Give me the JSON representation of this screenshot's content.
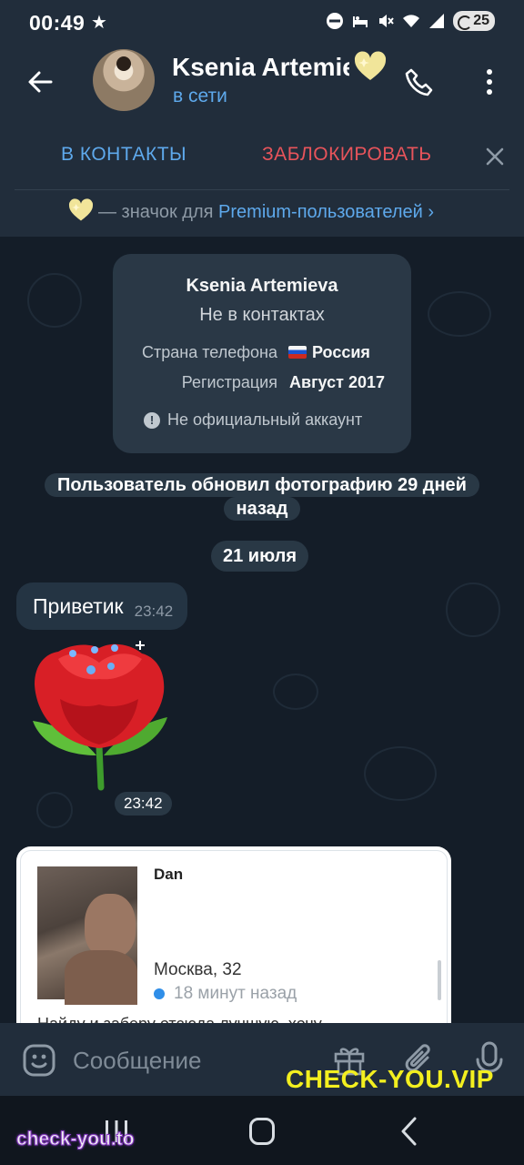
{
  "status_bar": {
    "time": "00:49",
    "star": "★",
    "battery": "25",
    "icons": [
      "star-icon",
      "dnd-icon",
      "bed-icon",
      "mute-icon",
      "wifi-icon",
      "signal-icon",
      "battery-icon"
    ]
  },
  "header": {
    "contact_name": "Ksenia Artemieva",
    "status": "в сети",
    "icons": [
      "back-arrow-icon",
      "premium-heart-icon",
      "phone-icon",
      "more-vert-icon"
    ]
  },
  "action_bar": {
    "add_contact": "В КОНТАКТЫ",
    "block": "ЗАБЛОКИРОВАТЬ"
  },
  "premium_notice": {
    "prefix": "— значок для ",
    "link": "Premium-пользователей",
    "chevron": "›"
  },
  "info_card": {
    "name": "Ksenia Artemieva",
    "subtitle": "Не в контактах",
    "phone_country_label": "Страна телефона",
    "phone_country_value": "Россия",
    "registration_label": "Регистрация",
    "registration_value": "Август 2017",
    "warning": "Не официальный аккаунт"
  },
  "service_message": "Пользователь обновил фотографию 29 дней назад",
  "date_chip": "21 июля",
  "messages": [
    {
      "type": "text",
      "text": "Приветик",
      "time": "23:42"
    },
    {
      "type": "sticker",
      "sticker": "red-rose",
      "time": "23:42"
    }
  ],
  "profile_card": {
    "name": "Dan",
    "city_age": "Москва, 32",
    "online": "18 минут назад",
    "description": "Найду и заберу отсюда лучшую, хочу"
  },
  "input_bar": {
    "placeholder": "Сообщение",
    "icons": [
      "emoji-icon",
      "gift-icon",
      "attach-icon",
      "mic-icon"
    ]
  },
  "watermarks": {
    "big": "CHECK-YOU.VIP",
    "small": "check-you.to"
  },
  "colors": {
    "accent_blue": "#5ea9ec",
    "danger_red": "#e8545b",
    "header_bg": "#212d3b",
    "chat_bg": "#141d28",
    "watermark_yellow": "#f3ef1f"
  }
}
